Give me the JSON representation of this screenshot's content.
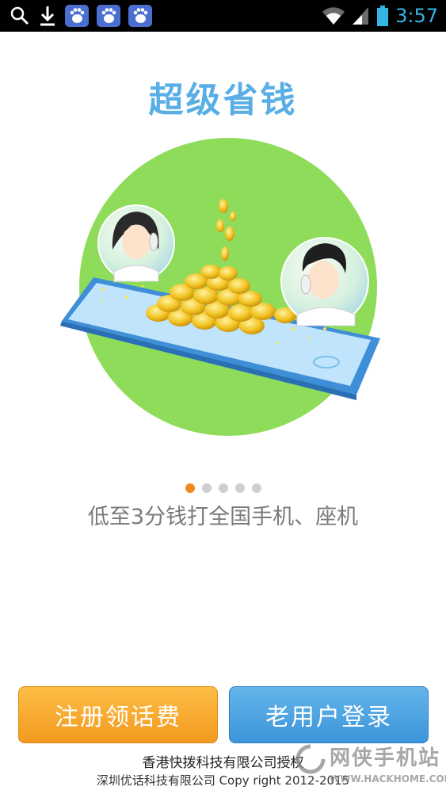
{
  "status_bar": {
    "time": "3:57",
    "icons": [
      "search-icon",
      "download-icon",
      "baidu-icon",
      "baidu-icon",
      "baidu-icon",
      "wifi-icon",
      "signal-icon",
      "battery-icon"
    ],
    "time_color": "#33b5e5"
  },
  "main": {
    "title": "超级省钱",
    "subtitle": "低至3分钱打全国手机、座机",
    "pager": {
      "count": 5,
      "active": 0
    },
    "colors": {
      "title": "#5aaee6",
      "circle": "#8fdc5a",
      "active_dot": "#f08a1e"
    }
  },
  "buttons": {
    "register_label": "注册领话费",
    "login_label": "老用户登录"
  },
  "footer": {
    "line1": "香港快拨科技有限公司授权",
    "line2": "深圳优话科技有限公司 Copy right 2012-2015"
  },
  "watermark": {
    "text": "网侠手机站",
    "url": "WWW.HACKHOME.COM"
  }
}
